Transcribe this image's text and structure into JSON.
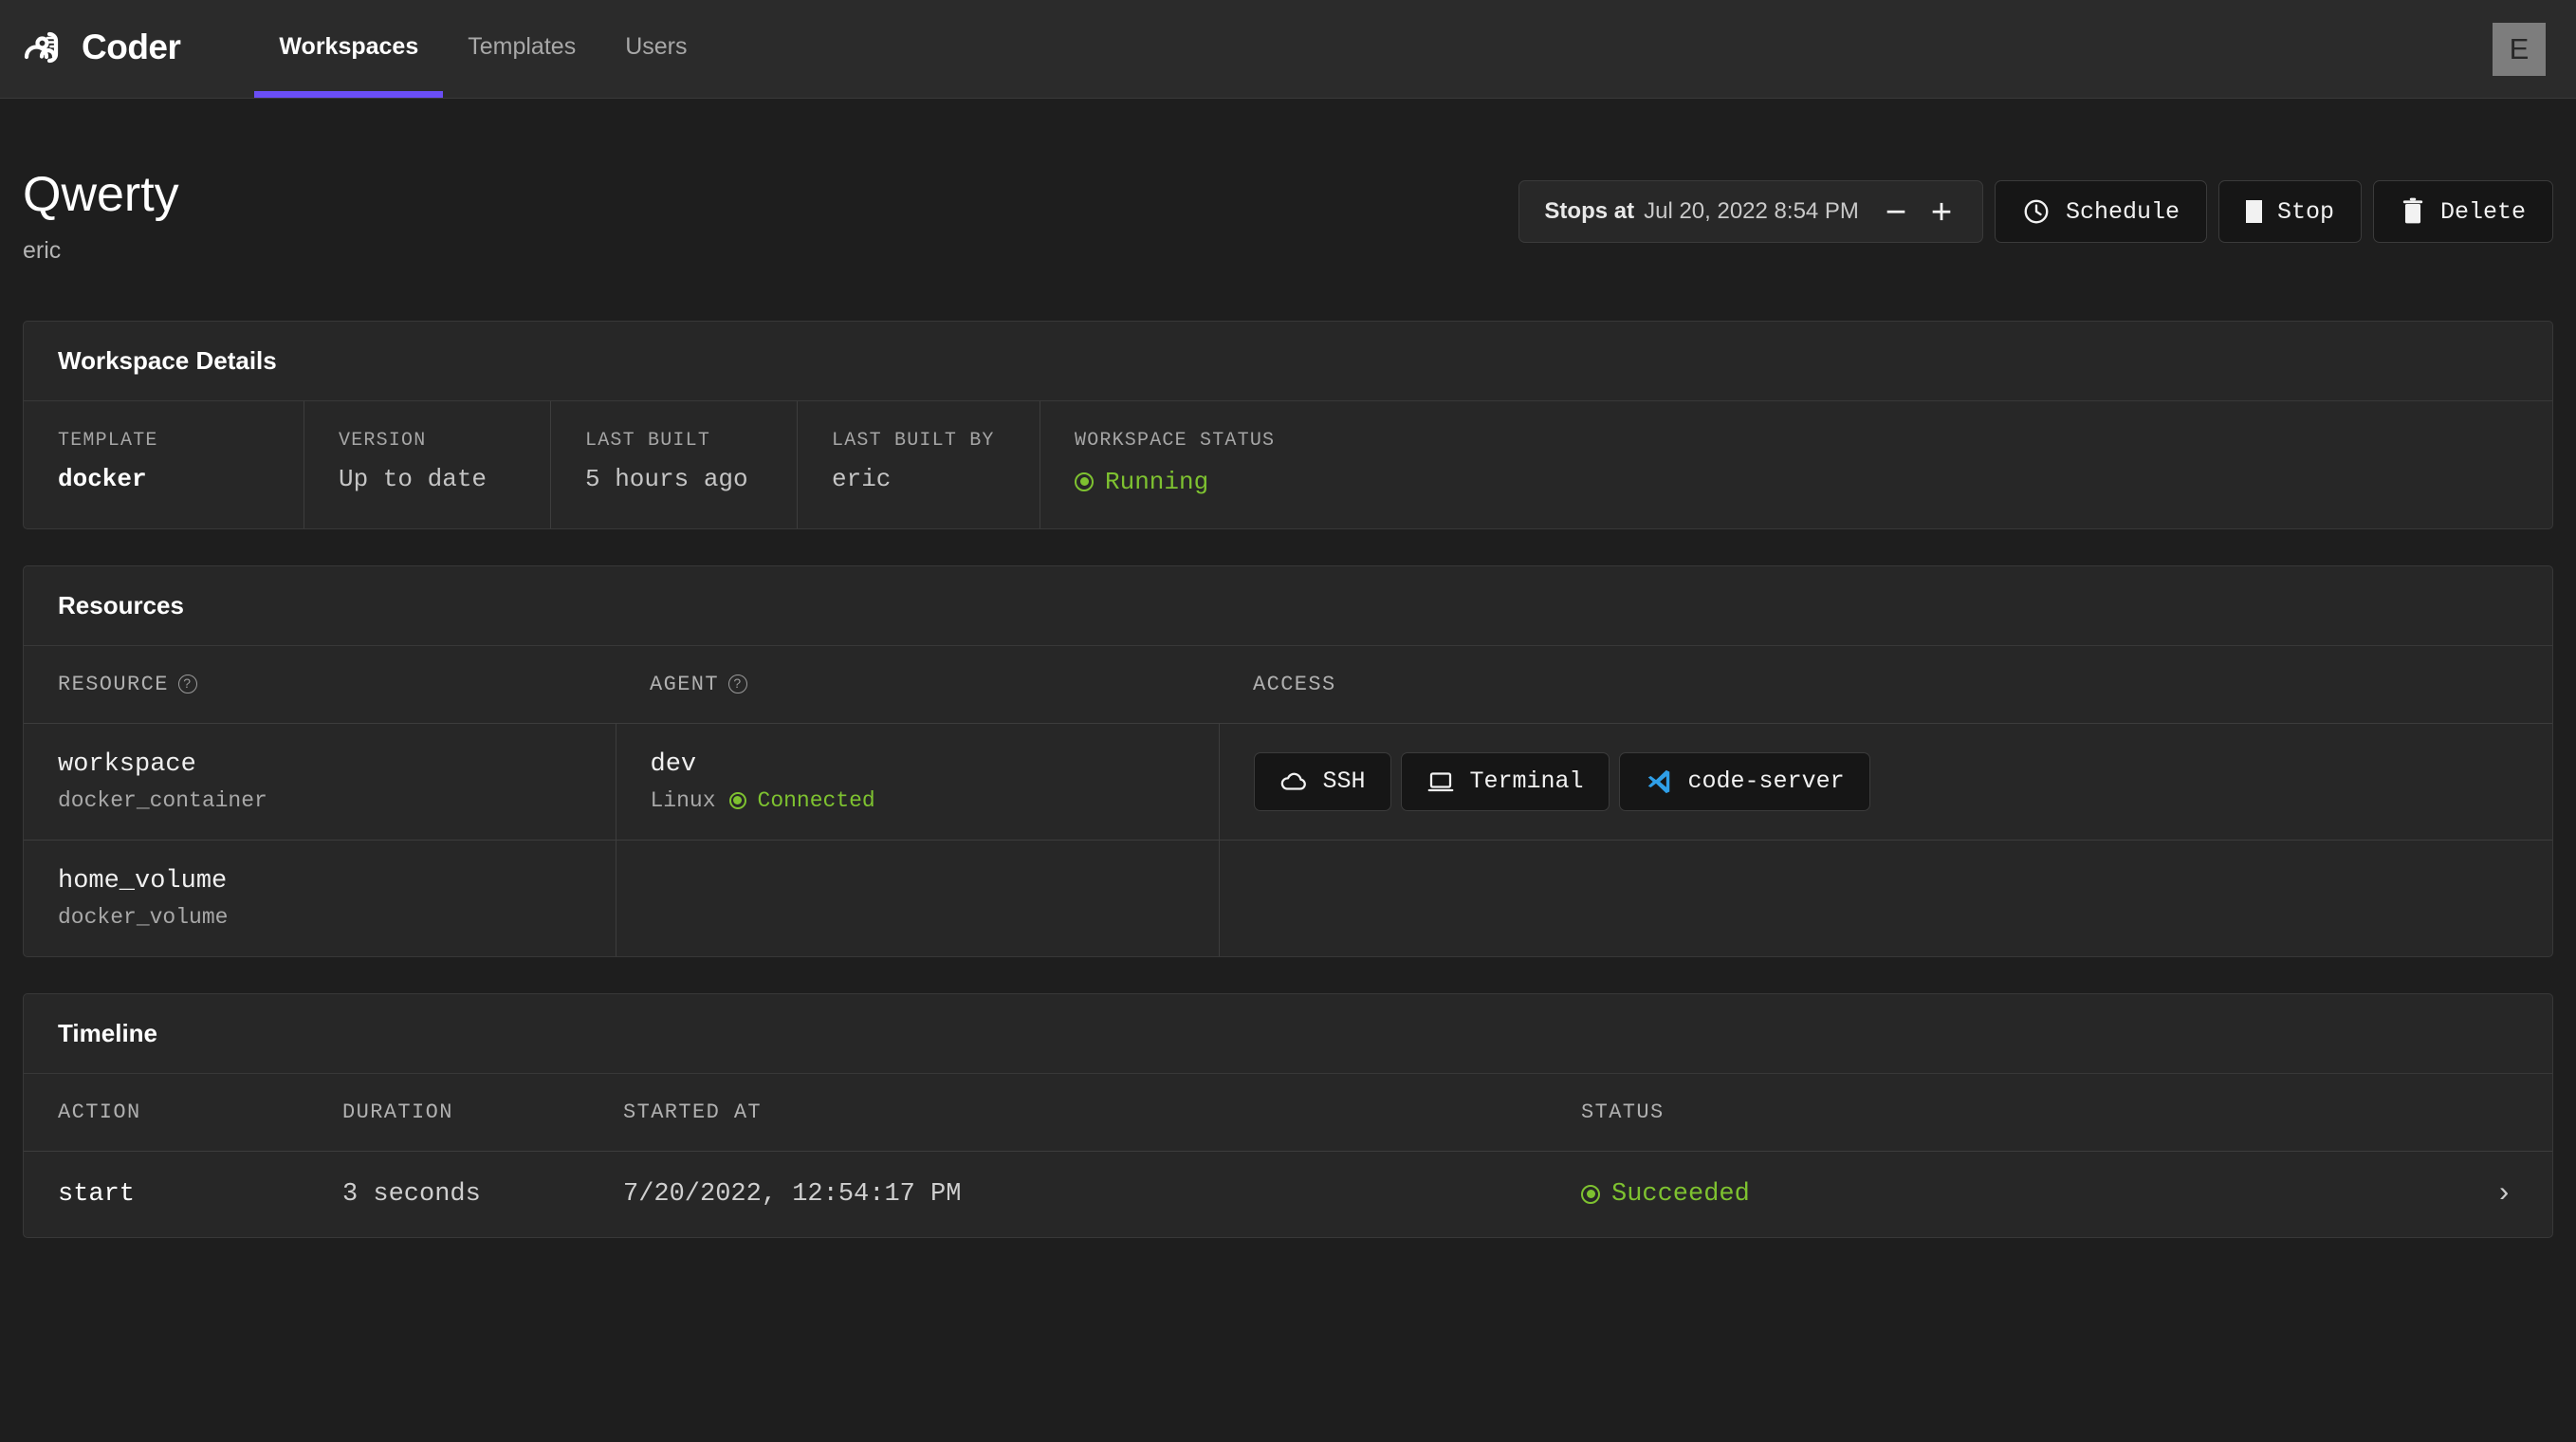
{
  "brand": {
    "name": "Coder",
    "logo_icon": "coder-logo-icon"
  },
  "nav": {
    "tabs": [
      {
        "label": "Workspaces",
        "active": true
      },
      {
        "label": "Templates",
        "active": false
      },
      {
        "label": "Users",
        "active": false
      }
    ],
    "avatar_initial": "E",
    "accent_color": "#6a4ef5"
  },
  "header": {
    "title": "Qwerty",
    "owner": "eric"
  },
  "actions": {
    "stops_label": "Stops at",
    "stops_value": "Jul 20, 2022 8:54 PM",
    "decrease_label": "−",
    "increase_label": "+",
    "schedule_label": "Schedule",
    "stop_label": "Stop",
    "delete_label": "Delete"
  },
  "workspace_details": {
    "title": "Workspace Details",
    "fields": [
      {
        "label": "TEMPLATE",
        "value": "docker",
        "strong": true
      },
      {
        "label": "VERSION",
        "value": "Up to date",
        "strong": false
      },
      {
        "label": "LAST BUILT",
        "value": "5 hours ago",
        "strong": false
      },
      {
        "label": "LAST BUILT BY",
        "value": "eric",
        "strong": false
      },
      {
        "label": "WORKSPACE STATUS",
        "value": "Running",
        "status": true
      }
    ],
    "status_color": "#7ec230"
  },
  "resources": {
    "title": "Resources",
    "columns": [
      {
        "label": "RESOURCE",
        "help": true
      },
      {
        "label": "AGENT",
        "help": true
      },
      {
        "label": "ACCESS",
        "help": false
      }
    ],
    "rows": [
      {
        "resource_name": "workspace",
        "resource_type": "docker_container",
        "agent_name": "dev",
        "agent_os": "Linux",
        "agent_status": "Connected",
        "access": [
          {
            "label": "SSH",
            "icon": "cloud-icon"
          },
          {
            "label": "Terminal",
            "icon": "terminal-icon"
          },
          {
            "label": "code-server",
            "icon": "vscode-icon"
          }
        ]
      },
      {
        "resource_name": "home_volume",
        "resource_type": "docker_volume",
        "agent_name": "",
        "agent_os": "",
        "agent_status": "",
        "access": []
      }
    ]
  },
  "timeline": {
    "title": "Timeline",
    "columns": [
      "ACTION",
      "DURATION",
      "STARTED AT",
      "STATUS"
    ],
    "rows": [
      {
        "action": "start",
        "duration": "3 seconds",
        "started_at": "7/20/2022, 12:54:17 PM",
        "status": "Succeeded"
      }
    ],
    "status_color": "#7ec230",
    "chevron": "›"
  }
}
